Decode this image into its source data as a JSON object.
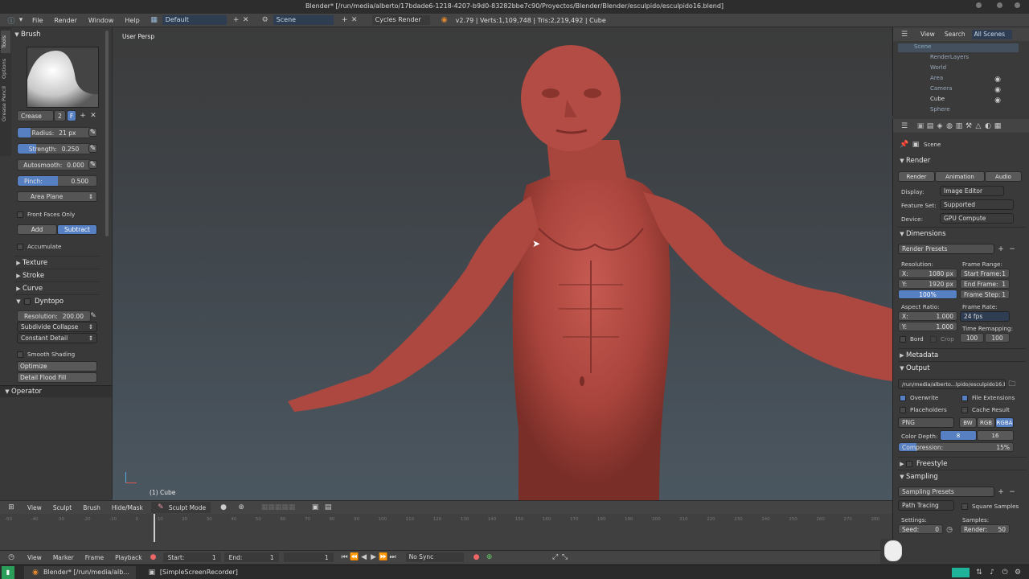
{
  "window_title": "Blender* [/run/media/alberto/17bdade6-1218-4207-b9d0-83282bbe7c90/Proyectos/Blender/Blender/esculpido/esculpido16.blend]",
  "menu": {
    "file": "File",
    "render": "Render",
    "window": "Window",
    "help": "Help",
    "layout": "Default",
    "scene": "Scene",
    "engine": "Cycles Render",
    "stats": "v2.79 | Verts:1,109,748 | Tris:2,219,492 | Cube"
  },
  "tool": {
    "vtabs": [
      "Tools",
      "Options",
      "Grease Pencil"
    ],
    "brush_header": "Brush",
    "brush_name": "Crease",
    "brush_users": "2",
    "brush_fake": "F",
    "radius_label": "Radius:",
    "radius_value": "21 px",
    "strength_label": "Strength:",
    "strength_value": "0.250",
    "autosmooth_label": "Autosmooth:",
    "autosmooth_value": "0.000",
    "pinch_label": "Pinch:",
    "pinch_value": "0.500",
    "area_plane": "Area Plane",
    "front_faces": "Front Faces Only",
    "add": "Add",
    "subtract": "Subtract",
    "accumulate": "Accumulate",
    "texture": "Texture",
    "stroke": "Stroke",
    "curve": "Curve",
    "dyntopo": "Dyntopo",
    "resolution_label": "Resolution:",
    "resolution_value": "200.00",
    "subdivide": "Subdivide Collapse",
    "constant": "Constant Detail",
    "smooth": "Smooth Shading",
    "optimize": "Optimize",
    "flood": "Detail Flood Fill",
    "operator": "Operator"
  },
  "viewport": {
    "label": "User Persp",
    "object": "(1) Cube"
  },
  "viewport_header": {
    "view": "View",
    "sculpt": "Sculpt",
    "brush": "Brush",
    "hide": "Hide/Mask",
    "mode": "Sculpt Mode"
  },
  "timeline": {
    "ticks": [
      "-50",
      "-40",
      "-30",
      "-20",
      "-10",
      "0",
      "10",
      "20",
      "30",
      "40",
      "50",
      "60",
      "70",
      "80",
      "90",
      "100",
      "110",
      "120",
      "130",
      "140",
      "150",
      "160",
      "170",
      "180",
      "190",
      "200",
      "210",
      "220",
      "230",
      "240",
      "250",
      "260",
      "270",
      "280"
    ],
    "view": "View",
    "marker": "Marker",
    "frame": "Frame",
    "playback": "Playback",
    "start_label": "Start:",
    "start_value": "1",
    "end_label": "End:",
    "end_value": "1",
    "current": "1",
    "sync": "No Sync"
  },
  "outliner": {
    "view": "View",
    "search": "Search",
    "filter": "All Scenes",
    "items": [
      "Scene",
      "RenderLayers",
      "World",
      "Area",
      "Camera",
      "Cube",
      "Sphere"
    ]
  },
  "props": {
    "scene": "Scene",
    "render_panel": "Render",
    "tab_render": "Render",
    "tab_animation": "Animation",
    "tab_audio": "Audio",
    "display_label": "Display:",
    "display_value": "Image Editor",
    "feature_label": "Feature Set:",
    "feature_value": "Supported",
    "device_label": "Device:",
    "device_value": "GPU Compute",
    "dimensions": "Dimensions",
    "presets": "Render Presets",
    "resolution": "Resolution:",
    "res_x": "X:",
    "res_x_val": "1080 px",
    "res_y": "Y:",
    "res_y_val": "1920 px",
    "res_pct": "100%",
    "frame_range": "Frame Range:",
    "start_frame": "Start Frame:",
    "start_frame_val": "1",
    "end_frame": "End Frame:",
    "end_frame_val": "1",
    "frame_step": "Frame Step:",
    "frame_step_val": "1",
    "aspect": "Aspect Ratio:",
    "asp_x": "X:",
    "asp_x_val": "1.000",
    "asp_y": "Y:",
    "asp_y_val": "1.000",
    "frame_rate": "Frame Rate:",
    "fps": "24 fps",
    "time_remap": "Time Remapping:",
    "remap_old": "100",
    "remap_new": "100",
    "bord": "Bord",
    "crop": "Crop",
    "metadata": "Metadata",
    "output": "Output",
    "output_path": "/run/media/alberto...lpido/esculpido16.blend",
    "overwrite": "Overwrite",
    "file_ext": "File Extensions",
    "placeholders": "Placeholders",
    "cache": "Cache Result",
    "format": "PNG",
    "bw": "BW",
    "rgb": "RGB",
    "rgba": "RGBA",
    "color_depth": "Color Depth:",
    "depth8": "8",
    "depth16": "16",
    "compression": "Compression:",
    "compression_val": "15%",
    "freestyle": "Freestyle",
    "sampling": "Sampling",
    "sampling_presets": "Sampling Presets",
    "path_tracing": "Path Tracing",
    "square": "Square Samples",
    "settings": "Settings:",
    "samples": "Samples:",
    "seed": "Seed:",
    "seed_val": "0",
    "render_samples": "Render:",
    "render_samples_val": "50"
  },
  "taskbar": {
    "app1": "Blender* [/run/media/alb...",
    "app2": "[SimpleScreenRecorder]"
  }
}
